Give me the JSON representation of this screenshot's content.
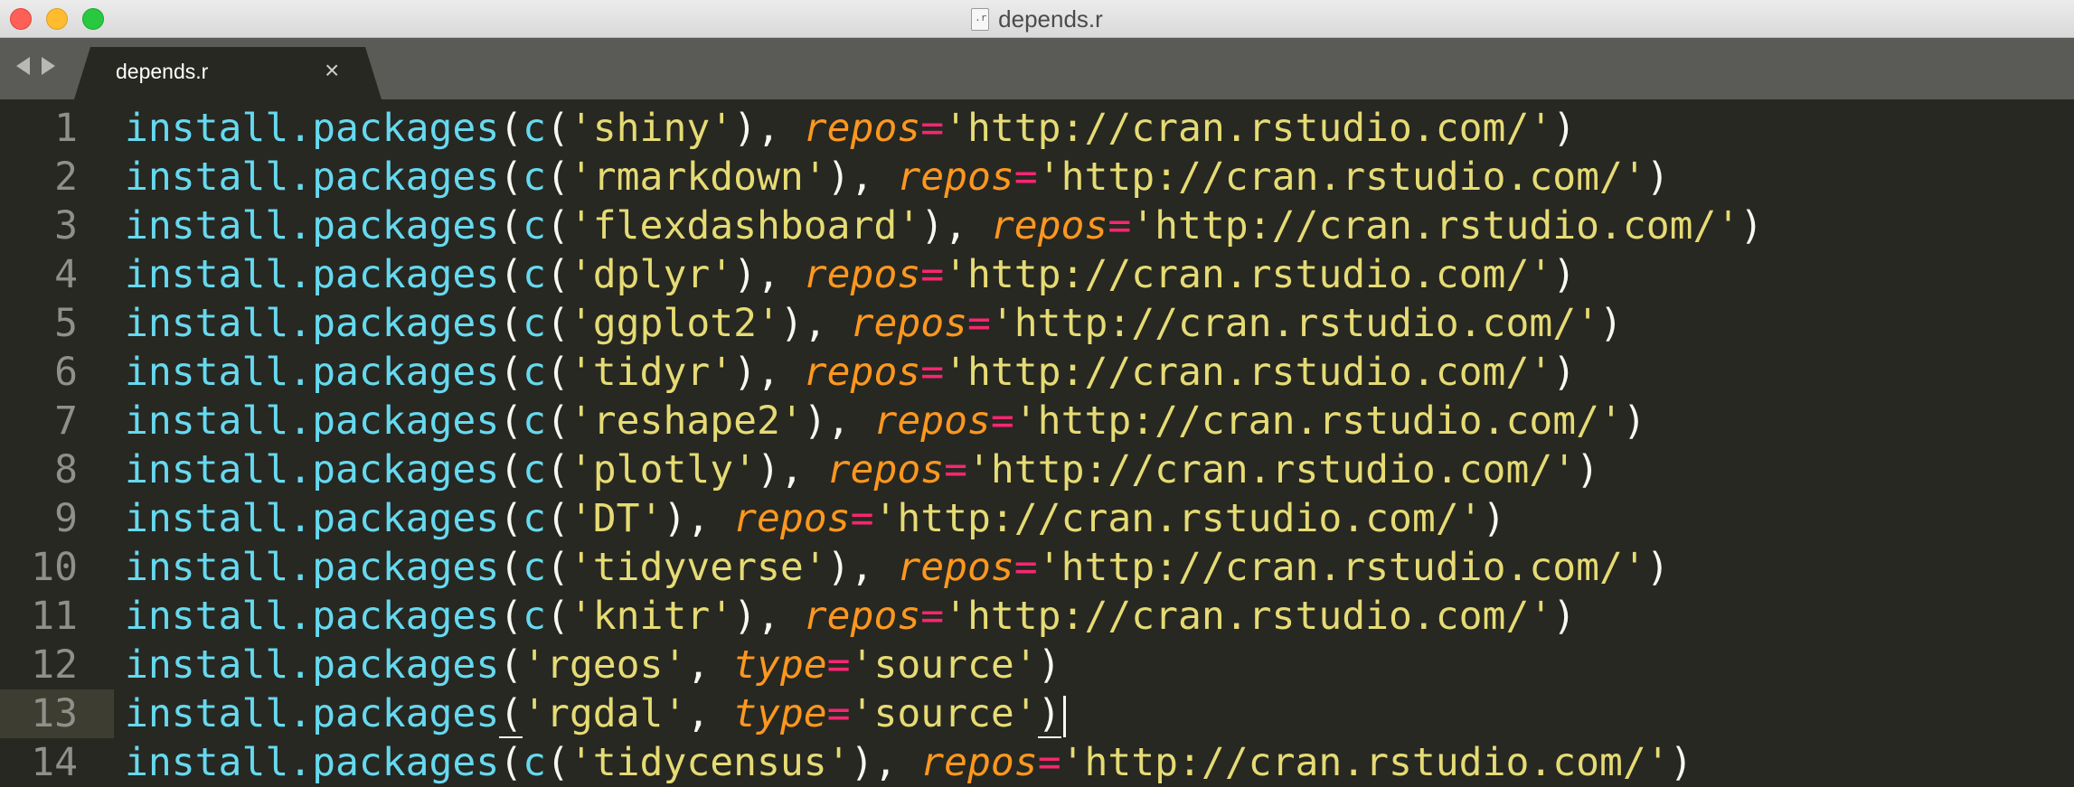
{
  "window": {
    "title": "depends.r",
    "file_icon_glyph": ".r"
  },
  "tab": {
    "label": "depends.r",
    "close_glyph": "×"
  },
  "colors": {
    "background": "#272822",
    "function": "#66d9ef",
    "string": "#e6db74",
    "argument": "#fd971f",
    "operator": "#f92672",
    "punctuation": "#f8f8f2",
    "line_number": "#8f908a"
  },
  "editor": {
    "current_line": 13,
    "lines": [
      {
        "num": "1",
        "fn": "install.packages",
        "pkg": "'shiny'",
        "wrapped": true,
        "arg": "repos",
        "val": "'http://cran.rstudio.com/'"
      },
      {
        "num": "2",
        "fn": "install.packages",
        "pkg": "'rmarkdown'",
        "wrapped": true,
        "arg": "repos",
        "val": "'http://cran.rstudio.com/'"
      },
      {
        "num": "3",
        "fn": "install.packages",
        "pkg": "'flexdashboard'",
        "wrapped": true,
        "arg": "repos",
        "val": "'http://cran.rstudio.com/'"
      },
      {
        "num": "4",
        "fn": "install.packages",
        "pkg": "'dplyr'",
        "wrapped": true,
        "arg": "repos",
        "val": "'http://cran.rstudio.com/'"
      },
      {
        "num": "5",
        "fn": "install.packages",
        "pkg": "'ggplot2'",
        "wrapped": true,
        "arg": "repos",
        "val": "'http://cran.rstudio.com/'"
      },
      {
        "num": "6",
        "fn": "install.packages",
        "pkg": "'tidyr'",
        "wrapped": true,
        "arg": "repos",
        "val": "'http://cran.rstudio.com/'"
      },
      {
        "num": "7",
        "fn": "install.packages",
        "pkg": "'reshape2'",
        "wrapped": true,
        "arg": "repos",
        "val": "'http://cran.rstudio.com/'"
      },
      {
        "num": "8",
        "fn": "install.packages",
        "pkg": "'plotly'",
        "wrapped": true,
        "arg": "repos",
        "val": "'http://cran.rstudio.com/'"
      },
      {
        "num": "9",
        "fn": "install.packages",
        "pkg": "'DT'",
        "wrapped": true,
        "arg": "repos",
        "val": "'http://cran.rstudio.com/'"
      },
      {
        "num": "10",
        "fn": "install.packages",
        "pkg": "'tidyverse'",
        "wrapped": true,
        "arg": "repos",
        "val": "'http://cran.rstudio.com/'"
      },
      {
        "num": "11",
        "fn": "install.packages",
        "pkg": "'knitr'",
        "wrapped": true,
        "arg": "repos",
        "val": "'http://cran.rstudio.com/'"
      },
      {
        "num": "12",
        "fn": "install.packages",
        "pkg": "'rgeos'",
        "wrapped": false,
        "arg": "type",
        "val": "'source'"
      },
      {
        "num": "13",
        "fn": "install.packages",
        "pkg": "'rgdal'",
        "wrapped": false,
        "arg": "type",
        "val": "'source'"
      },
      {
        "num": "14",
        "fn": "install.packages",
        "pkg": "'tidycensus'",
        "wrapped": true,
        "arg": "repos",
        "val": "'http://cran.rstudio.com/'"
      }
    ]
  }
}
